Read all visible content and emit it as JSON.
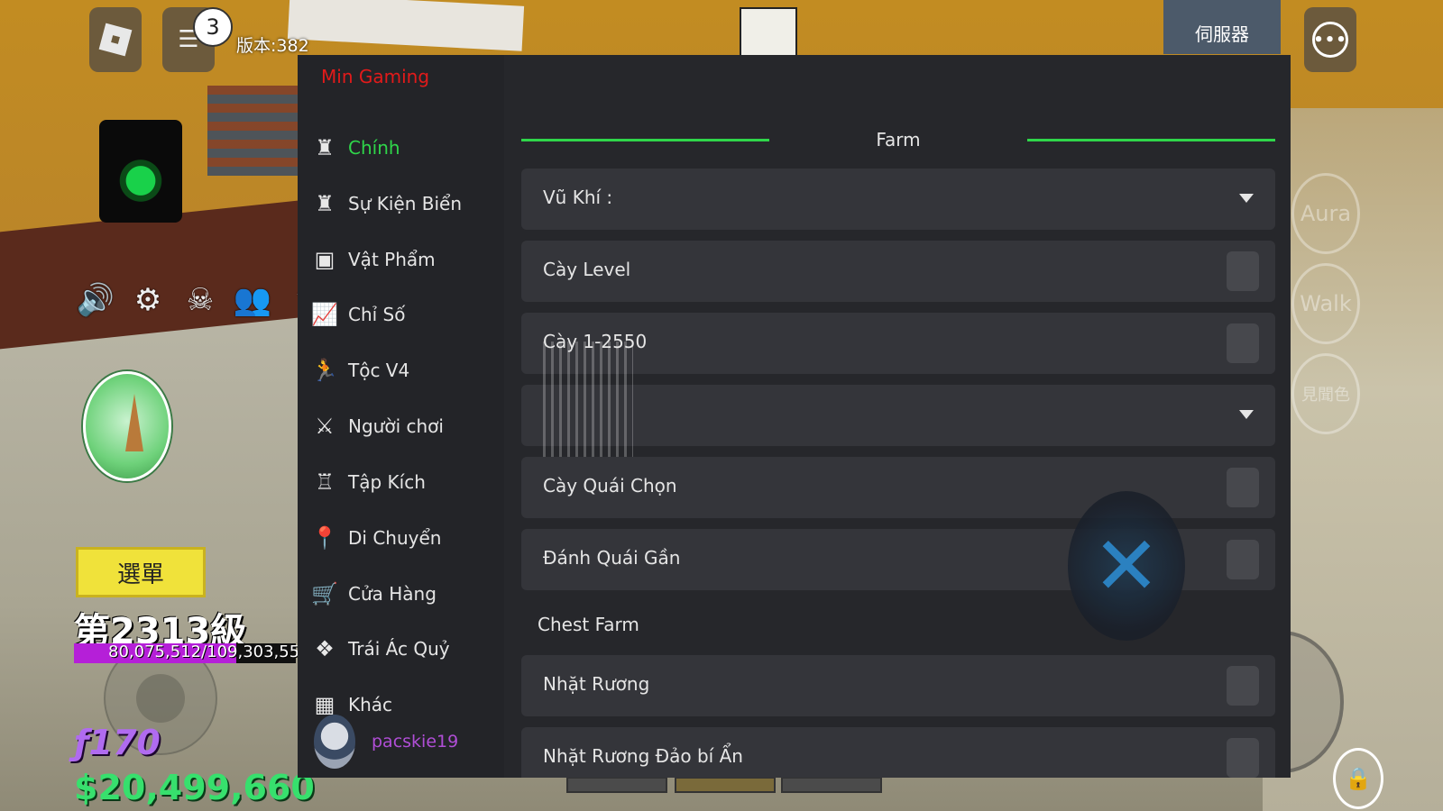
{
  "top_bar": {
    "chat_badge": "3",
    "version": "版本:382",
    "server_label": "伺服器"
  },
  "hud": {
    "menu_label": "選單",
    "level": "第2313級",
    "xp_text": "80,075,512/109,303,555",
    "xp_fraction": 0.73,
    "fragments": "ƒ170",
    "money": "$20,499,660",
    "icons": [
      "speaker-icon",
      "gear-icon",
      "pirate-skull-icon",
      "crew-icon",
      "arrow-up-icon"
    ]
  },
  "right_buttons": {
    "aura": "Aura",
    "walk": "Walk",
    "observation": "見聞色"
  },
  "panel": {
    "brand": "Min Gaming",
    "sidebar": [
      {
        "label": "Chính",
        "icon": "character-icon",
        "active": true
      },
      {
        "label": "Sự Kiện Biển",
        "icon": "character-icon",
        "active": false
      },
      {
        "label": "Vật Phẩm",
        "icon": "robot-icon",
        "active": false
      },
      {
        "label": "Chỉ Số",
        "icon": "chart-icon",
        "active": false
      },
      {
        "label": "Tộc V4",
        "icon": "runner-icon",
        "active": false
      },
      {
        "label": "Người chơi",
        "icon": "crossed-swords-icon",
        "active": false
      },
      {
        "label": "Tập Kích",
        "icon": "castle-icon",
        "active": false
      },
      {
        "label": "Di Chuyển",
        "icon": "location-pin-icon",
        "active": false
      },
      {
        "label": "Cửa Hàng",
        "icon": "shopping-cart-icon",
        "active": false
      },
      {
        "label": "Trái Ác Quỷ",
        "icon": "fruit-icon",
        "active": false
      },
      {
        "label": "Khác",
        "icon": "grid-icon",
        "active": false
      }
    ],
    "user": {
      "name": "pacskie19"
    },
    "section_title": "Farm",
    "rows": {
      "weapon": "Vũ Khí :",
      "farm_level": "Cày Level",
      "farm_1_2550": "Cày 1-2550",
      "farm_selected_mob": "Cày Quái Chọn",
      "attack_nearby": "Đánh Quái Gần",
      "chest_farm": "Chest Farm",
      "collect_chest": "Nhặt Rương",
      "collect_chest_mystic": "Nhặt Rương Đảo bí Ẩn"
    }
  }
}
